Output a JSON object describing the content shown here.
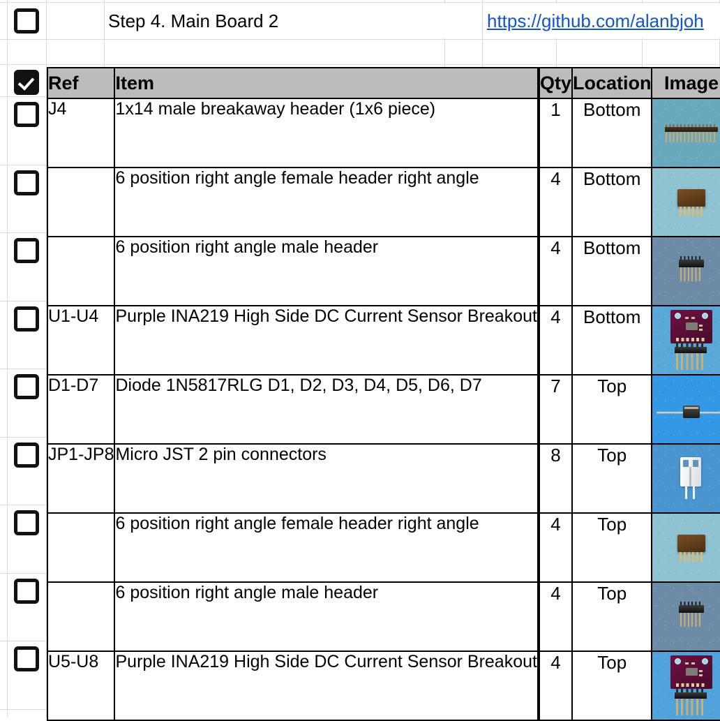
{
  "document": {
    "title": "Step 4. Main Board  2",
    "link_text": "https://github.com/alanbjoh"
  },
  "table": {
    "headers": {
      "ref": "Ref",
      "item": "Item",
      "blank": "",
      "qty": "Qty",
      "location": "Location",
      "image": "Image"
    },
    "rows": [
      {
        "checked": false,
        "ref": "J4",
        "item": "1x14 male breakaway header (1x6 piece)",
        "qty": "1",
        "location": "Bottom",
        "image_kind": "pin-header-1x14",
        "image_bg": "#6aa8bd"
      },
      {
        "checked": false,
        "ref": "",
        "item": "6 position right angle female header right angle",
        "qty": "4",
        "location": "Bottom",
        "image_kind": "right-angle-female-header",
        "image_bg": "#8fc3d2"
      },
      {
        "checked": false,
        "ref": "",
        "item": "6 position right angle male header",
        "qty": "4",
        "location": "Bottom",
        "image_kind": "right-angle-male-header",
        "image_bg": "#6d8ba6"
      },
      {
        "checked": false,
        "ref": "U1-U4",
        "item": "Purple INA219 High Side DC Current Sensor Breakout",
        "qty": "4",
        "location": "Bottom",
        "image_kind": "ina219-breakout",
        "image_bg": "#5aa8d8"
      },
      {
        "checked": false,
        "ref": "D1-D7",
        "item": "Diode 1N5817RLG D1, D2, D3, D4, D5, D6, D7",
        "qty": "7",
        "location": "Top",
        "image_kind": "axial-diode",
        "image_bg": "#3399e6"
      },
      {
        "checked": false,
        "ref": "JP1-JP8",
        "item": "Micro JST 2 pin connectors",
        "qty": "8",
        "location": "Top",
        "image_kind": "jst-connector",
        "image_bg": "#4a94cf"
      },
      {
        "checked": false,
        "ref": "",
        "item": "6 position right angle female header right angle",
        "qty": "4",
        "location": "Top",
        "image_kind": "right-angle-female-header",
        "image_bg": "#8fc3d2"
      },
      {
        "checked": false,
        "ref": "",
        "item": "6 position right angle male header",
        "qty": "4",
        "location": "Top",
        "image_kind": "right-angle-male-header",
        "image_bg": "#6d8ba6"
      },
      {
        "checked": false,
        "ref": "U5-U8",
        "item": "Purple INA219 High Side DC Current Sensor Breakout",
        "qty": "4",
        "location": "Top",
        "image_kind": "ina219-breakout",
        "image_bg": "#4fa3da"
      }
    ]
  },
  "checkboxes": {
    "title_row_checked": false,
    "header_row_checked": true
  },
  "colors": {
    "header_fill": "#bcbcbc",
    "grid": "#d9d9d9",
    "border": "#000000",
    "link": "#1155cc"
  }
}
